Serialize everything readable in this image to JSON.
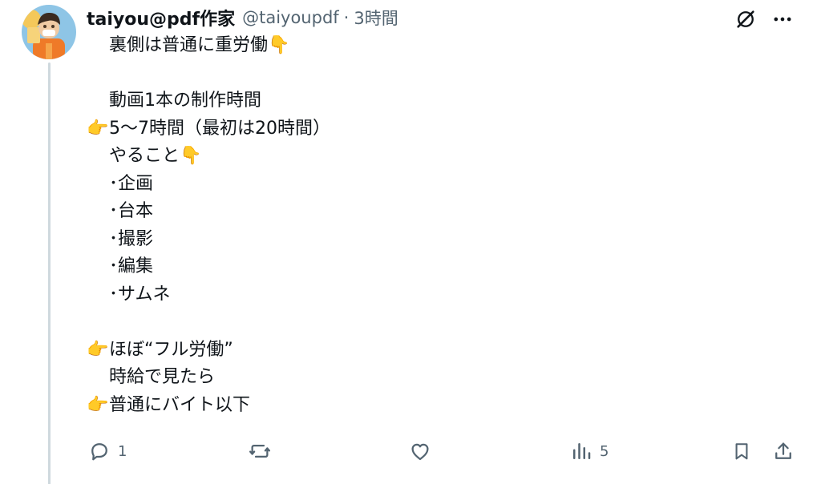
{
  "tweet": {
    "author": {
      "display_name": "taiyou@pdf作家",
      "handle": "@taiyoupdf",
      "separator": "·",
      "timestamp": "3時間",
      "avatar": "avatar-illustration"
    },
    "lines": [
      {
        "emoji": "",
        "text": "裏側は普通に重労働",
        "trailing_emoji": "👇"
      },
      {
        "emoji": "",
        "text": "",
        "trailing_emoji": ""
      },
      {
        "emoji": "",
        "text": "動画1本の制作時間",
        "trailing_emoji": ""
      },
      {
        "emoji": "👉",
        "text": "5〜7時間（最初は20時間）",
        "trailing_emoji": ""
      },
      {
        "emoji": "",
        "text": "やること",
        "trailing_emoji": "👇"
      },
      {
        "emoji": "",
        "text": "･企画",
        "trailing_emoji": ""
      },
      {
        "emoji": "",
        "text": "･台本",
        "trailing_emoji": ""
      },
      {
        "emoji": "",
        "text": "･撮影",
        "trailing_emoji": ""
      },
      {
        "emoji": "",
        "text": "･編集",
        "trailing_emoji": ""
      },
      {
        "emoji": "",
        "text": "･サムネ",
        "trailing_emoji": ""
      },
      {
        "emoji": "",
        "text": "",
        "trailing_emoji": ""
      },
      {
        "emoji": "👉",
        "text": "ほぼ“フル労働”",
        "trailing_emoji": ""
      },
      {
        "emoji": "",
        "text": "時給で見たら",
        "trailing_emoji": ""
      },
      {
        "emoji": "👉",
        "text": "普通にバイト以下",
        "trailing_emoji": ""
      }
    ]
  },
  "top_actions": {
    "grok_icon": "grok-slash-icon",
    "more_icon": "more-dots-icon"
  },
  "actions": {
    "reply_count": "1",
    "repost_count": "",
    "like_count": "",
    "views_count": "5",
    "reply_icon": "reply-icon",
    "repost_icon": "repost-icon",
    "like_icon": "heart-icon",
    "views_icon": "views-bar-icon",
    "bookmark_icon": "bookmark-icon",
    "share_icon": "share-icon"
  },
  "colors": {
    "text": "#0f1419",
    "secondary": "#536471",
    "thread_line": "#cfd9de"
  }
}
